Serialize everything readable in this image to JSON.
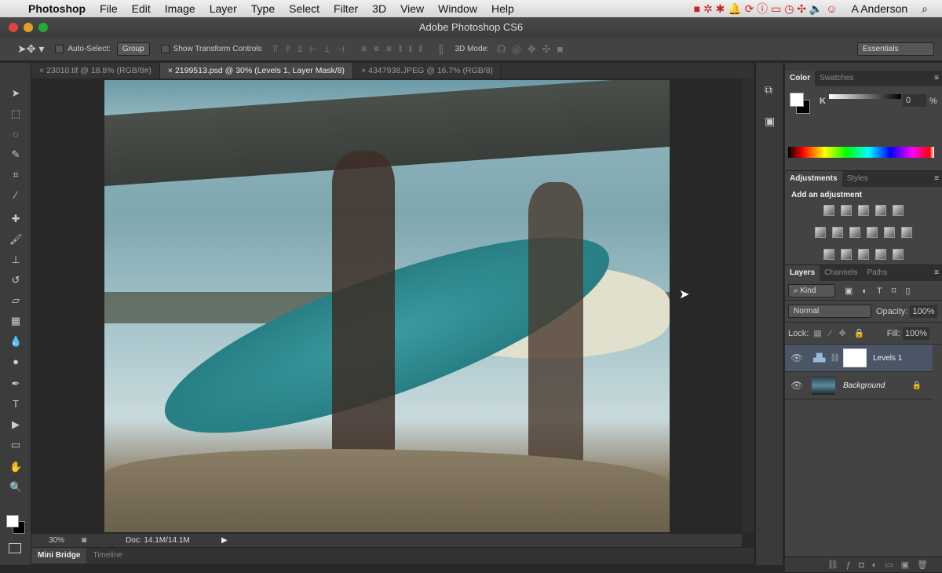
{
  "menubar": {
    "app": "Photoshop",
    "items": [
      "File",
      "Edit",
      "Image",
      "Layer",
      "Type",
      "Select",
      "Filter",
      "3D",
      "View",
      "Window",
      "Help"
    ],
    "user": "A Anderson"
  },
  "window": {
    "title": "Adobe Photoshop CS6"
  },
  "options": {
    "auto_select": "Auto-Select:",
    "auto_select_value": "Group",
    "transform": "Show Transform Controls",
    "mode3d": "3D Mode:",
    "workspace": "Essentials"
  },
  "tabs": [
    {
      "label": "23010.tif @ 18.8% (RGB/8#)"
    },
    {
      "label": "2199513.psd @ 30% (Levels 1, Layer Mask/8)"
    },
    {
      "label": "4347938.JPEG @ 16.7% (RGB/8)"
    }
  ],
  "status": {
    "zoom": "30%",
    "doc": "Doc: 14.1M/14.1M"
  },
  "bottom_tabs": [
    "Mini Bridge",
    "Timeline"
  ],
  "color_panel": {
    "tabs": [
      "Color",
      "Swatches"
    ],
    "channel": "K",
    "value": "0",
    "unit": "%"
  },
  "adjustments": {
    "tabs": [
      "Adjustments",
      "Styles"
    ],
    "heading": "Add an adjustment"
  },
  "layers_panel": {
    "tabs": [
      "Layers",
      "Channels",
      "Paths"
    ],
    "filter": "Kind",
    "blend": "Normal",
    "opacity_label": "Opacity:",
    "opacity": "100%",
    "lock_label": "Lock:",
    "fill_label": "Fill:",
    "fill": "100%",
    "layers": [
      {
        "name": "Levels 1",
        "selected": true
      },
      {
        "name": "Background",
        "selected": false
      }
    ]
  }
}
